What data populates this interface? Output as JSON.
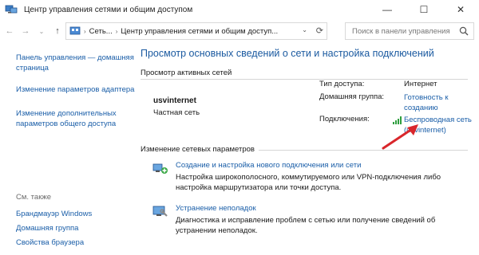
{
  "window": {
    "title": "Центр управления сетями и общим доступом",
    "controls": {
      "minimize": "—",
      "maximize": "☐",
      "close": "✕"
    }
  },
  "addressbar": {
    "back": "←",
    "forward": "→",
    "dropdown": "⌄",
    "up": "↑",
    "segments": [
      "Сеть...",
      "Центр управления сетями и общим доступ..."
    ],
    "separator": "›",
    "search_placeholder": "Поиск в панели управления"
  },
  "sidebar": {
    "items": [
      {
        "label": "Панель управления — домашняя страница"
      },
      {
        "label": "Изменение параметров адаптера"
      },
      {
        "label": "Изменение дополнительных параметров общего доступа"
      }
    ],
    "see_also_label": "См. также",
    "see_also": [
      {
        "label": "Брандмауэр Windows"
      },
      {
        "label": "Домашняя группа"
      },
      {
        "label": "Свойства браузера"
      }
    ]
  },
  "main": {
    "title": "Просмотр основных сведений о сети и настройка подключений",
    "active_networks_heading": "Просмотр активных сетей",
    "network": {
      "name": "usvinternet",
      "category": "Частная сеть",
      "access_type_label": "Тип доступа:",
      "access_type_value": "Интернет",
      "homegroup_label": "Домашняя группа:",
      "homegroup_value": "Готовность к созданию",
      "connections_label": "Подключения:",
      "connection_value": "Беспроводная сеть (usvinternet)"
    },
    "change_settings_heading": "Изменение сетевых параметров",
    "tasks": [
      {
        "link": "Создание и настройка нового подключения или сети",
        "description": "Настройка широкополосного, коммутируемого или VPN-подключения либо настройка маршрутизатора или точки доступа.",
        "icon": "new-connection-icon"
      },
      {
        "link": "Устранение неполадок",
        "description": "Диагностика и исправление проблем с сетью или получение сведений об устранении неполадок.",
        "icon": "troubleshoot-icon"
      }
    ]
  },
  "colors": {
    "link": "#1a5ea8",
    "title": "#1b5aa0",
    "arrow": "#d9262b",
    "signal": "#2e9e3e"
  }
}
